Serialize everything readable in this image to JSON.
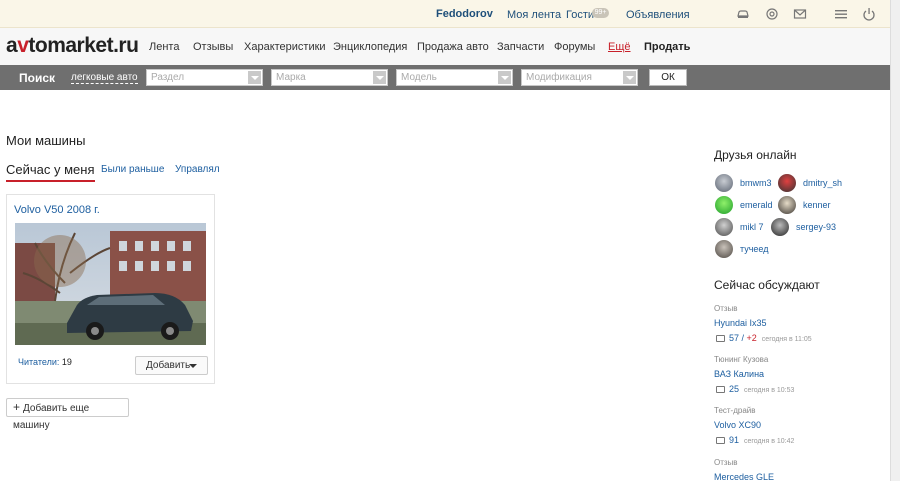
{
  "userbar": {
    "username": "Fedodorov",
    "links": [
      "Моя лента",
      "Гости",
      "Объявления"
    ],
    "guests_badge": "99+",
    "icons": [
      "car-icon",
      "at-icon",
      "mail-icon",
      "menu-icon",
      "power-icon"
    ]
  },
  "header": {
    "logo_prefix": "a",
    "logo_v": "v",
    "logo_rest": "tomarket.ru",
    "nav": [
      "Лента",
      "Отзывы",
      "Характеристики",
      "Энциклопедия",
      "Продажа авто",
      "Запчасти",
      "Форумы"
    ],
    "more": "Ещё",
    "sell": "Продать"
  },
  "search": {
    "title": "Поиск",
    "kind": "легковые авто",
    "selects": [
      "Раздел",
      "Марка",
      "Модель",
      "Модификация"
    ],
    "ok": "ОК"
  },
  "main": {
    "title": "Мои машины",
    "tabs": [
      "Сейчас у меня",
      "Были раньше",
      "Управлял"
    ],
    "card": {
      "title": "Volvo V50 2008 г.",
      "readers_label": "Читатели:",
      "readers_count": "19",
      "add_button": "Добавить"
    },
    "add_car": "Добавить еще машину"
  },
  "sidebar": {
    "friends_title": "Друзья онлайн",
    "friends": [
      "bmwm3",
      "dmitry_sh",
      "emerald",
      "kenner",
      "mikl 7",
      "sergey-93",
      "тучеед"
    ],
    "discuss_title": "Сейчас обсуждают",
    "discussions": [
      {
        "category": "Отзыв",
        "topic": "Hyundai Ix35",
        "comments": "57",
        "plus": "+2",
        "time": "сегодня в 11:05"
      },
      {
        "category": "Тюнинг Кузова",
        "topic": "ВАЗ Калина",
        "comments": "25",
        "plus": "",
        "time": "сегодня в 10:53"
      },
      {
        "category": "Тест-драйв",
        "topic": "Volvo XC90",
        "comments": "91",
        "plus": "",
        "time": "сегодня в 10:42"
      },
      {
        "category": "Отзыв",
        "topic": "Mercedes GLE",
        "comments": "",
        "plus": "",
        "time": ""
      }
    ]
  },
  "colors": {
    "brand_red": "#c8202a",
    "link_blue": "#1e5fa0",
    "search_bar": "#6f6f6f"
  }
}
